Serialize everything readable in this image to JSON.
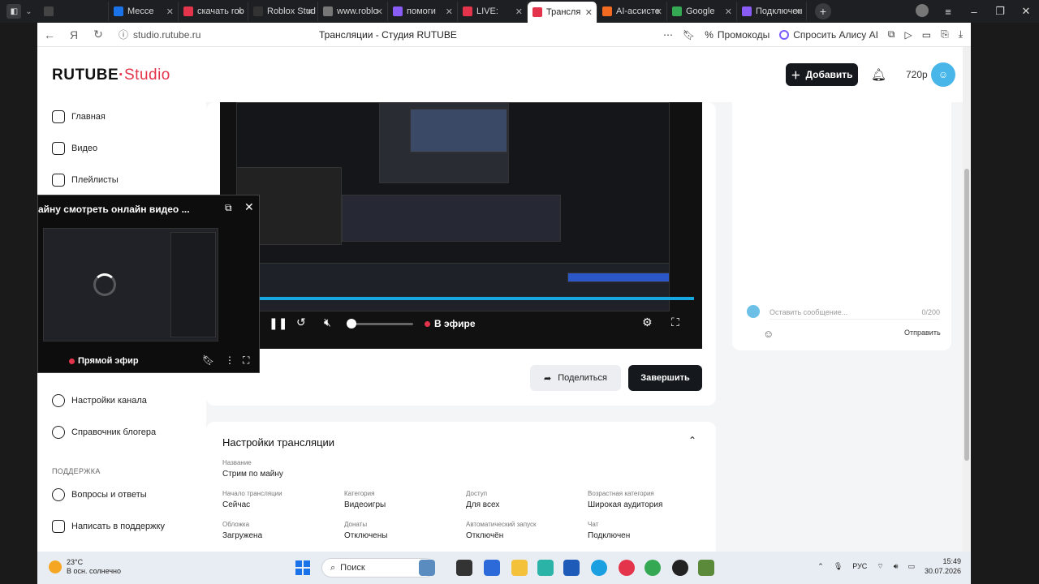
{
  "browser": {
    "tabs": [
      {
        "label": "",
        "color": "#444"
      },
      {
        "label": "Мессе",
        "color": "#1a73e8"
      },
      {
        "label": "скачать rob",
        "color": "#e4344b"
      },
      {
        "label": "Roblox Stud",
        "color": "#333"
      },
      {
        "label": "www.roblo",
        "color": "#777"
      },
      {
        "label": "помоги",
        "color": "#8a5cf6"
      },
      {
        "label": "LIVE:",
        "color": "#e4344b"
      },
      {
        "label": "Трансля",
        "color": "#e4344b",
        "active": true
      },
      {
        "label": "AI-ассисте",
        "color": "#f26b21"
      },
      {
        "label": "Google",
        "color": "#34a853"
      },
      {
        "label": "Подключен",
        "color": "#8a5cf6"
      }
    ],
    "url": "studio.rutube.ru",
    "page_title": "Трансляции - Студия RUTUBE",
    "promo": "Промокоды",
    "alisa": "Спросить Алису AI"
  },
  "header": {
    "logo_main": "RUTUBE",
    "logo_studio": "Studio",
    "add_label": "Добавить",
    "quality": "720p"
  },
  "sidebar": {
    "items": [
      {
        "label": "Главная"
      },
      {
        "label": "Видео"
      },
      {
        "label": "Плейлисты"
      },
      {
        "label": "Настройки канала"
      },
      {
        "label": "Справочник блогера"
      }
    ],
    "support_section": "ПОДДЕРЖКА",
    "support_items": [
      {
        "label": "Вопросы и ответы"
      },
      {
        "label": "Написать в поддержку"
      }
    ]
  },
  "player": {
    "live_label": "В эфире",
    "progress_fraction": 1.0,
    "volume_fraction": 0.0
  },
  "actions": {
    "share": "Поделиться",
    "end": "Завершить"
  },
  "chat": {
    "placeholder": "Оставить сообщение...",
    "counter": "0/200",
    "send": "Отправить"
  },
  "settings": {
    "title": "Настройки трансляции",
    "name_label": "Название",
    "name_value": "Стрим по майну",
    "fields": [
      {
        "label": "Начало трансляции",
        "value": "Сейчас"
      },
      {
        "label": "Категория",
        "value": "Видеоигры"
      },
      {
        "label": "Доступ",
        "value": "Для всех"
      },
      {
        "label": "Возрастная категория",
        "value": "Широкая аудитория"
      },
      {
        "label": "Обложка",
        "value": "Загружена"
      },
      {
        "label": "Донаты",
        "value": "Отключены"
      },
      {
        "label": "Автоматический запуск",
        "value": "Отключён"
      },
      {
        "label": "Чат",
        "value": "Подключен"
      }
    ]
  },
  "mini_player": {
    "title": "айну смотреть онлайн видео ...",
    "live_label": "Прямой эфир"
  },
  "taskbar": {
    "temp": "23°C",
    "weather": "В осн. солнечно",
    "search": "Поиск",
    "lang": "РУС",
    "time": "15:49",
    "date": "30.07.2026"
  }
}
